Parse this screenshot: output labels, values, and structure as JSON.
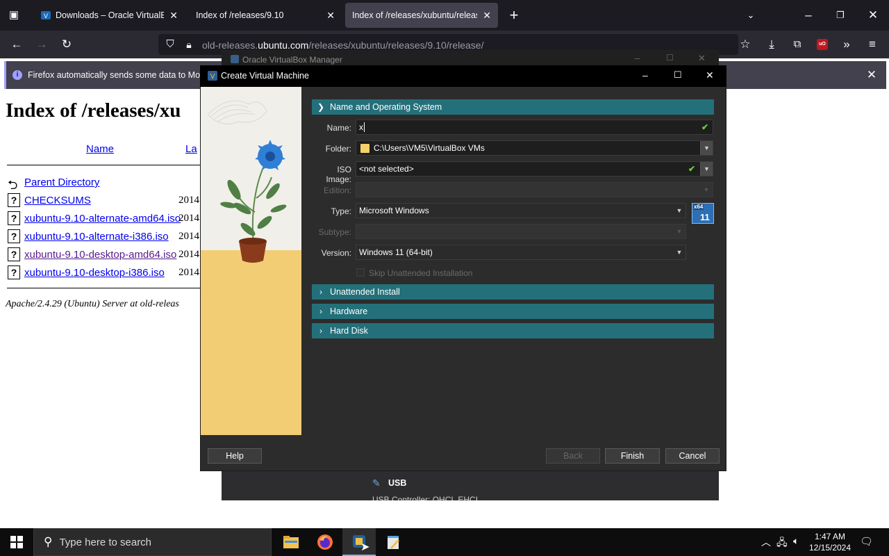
{
  "browser": {
    "tabs": [
      {
        "title": "Downloads – Oracle VirtualBox",
        "active": false
      },
      {
        "title": "Index of /releases/9.10",
        "active": false
      },
      {
        "title": "Index of /releases/xubuntu/release",
        "active": true
      }
    ],
    "url_prefix": "old-releases.",
    "url_domain": "ubuntu.com",
    "url_path": "/releases/xubuntu/releases/9.10/release/",
    "notification": "Firefox automatically sends some data to Mozil"
  },
  "page": {
    "heading": "Index of /releases/xu",
    "col_name": "Name",
    "col_last": "La",
    "parent": "Parent Directory",
    "files": [
      {
        "name": "CHECKSUMS",
        "date": "2014",
        "visited": false
      },
      {
        "name": "xubuntu-9.10-alternate-amd64.iso",
        "date": "2014",
        "visited": false
      },
      {
        "name": "xubuntu-9.10-alternate-i386.iso",
        "date": "2014",
        "visited": false
      },
      {
        "name": "xubuntu-9.10-desktop-amd64.iso",
        "date": "2014",
        "visited": true
      },
      {
        "name": "xubuntu-9.10-desktop-i386.iso",
        "date": "2014",
        "visited": false
      }
    ],
    "footer": "Apache/2.4.29 (Ubuntu) Server at old-releas"
  },
  "vbox_manager": {
    "title": "Oracle VirtualBox Manager",
    "usb_label": "USB",
    "usb_detail": "USB Controller:   OHCI, EHCI"
  },
  "dialog": {
    "title": "Create Virtual Machine",
    "section_name_os": "Name and Operating System",
    "name_label": "Name:",
    "name_value": "x",
    "folder_label": "Folder:",
    "folder_value": "C:\\Users\\VM5\\VirtualBox VMs",
    "iso_label": "ISO Image:",
    "iso_value": "<not selected>",
    "edition_label": "Edition:",
    "type_label": "Type:",
    "type_value": "Microsoft Windows",
    "subtype_label": "Subtype:",
    "version_label": "Version:",
    "version_value": "Windows 11 (64-bit)",
    "os_badge_top": "x64",
    "os_badge_num": "11",
    "skip_unattended": "Skip Unattended Installation",
    "section_unattended": "Unattended Install",
    "section_hardware": "Hardware",
    "section_harddisk": "Hard Disk",
    "help": "Help",
    "back": "Back",
    "finish": "Finish",
    "cancel": "Cancel"
  },
  "taskbar": {
    "search_placeholder": "Type here to search",
    "time": "1:47 AM",
    "date": "12/15/2024"
  },
  "colors": {
    "section_header": "#24707a",
    "browser_bg": "#1c1b22",
    "dialog_bg": "#2c2c2c",
    "check": "#6ccf3c"
  }
}
